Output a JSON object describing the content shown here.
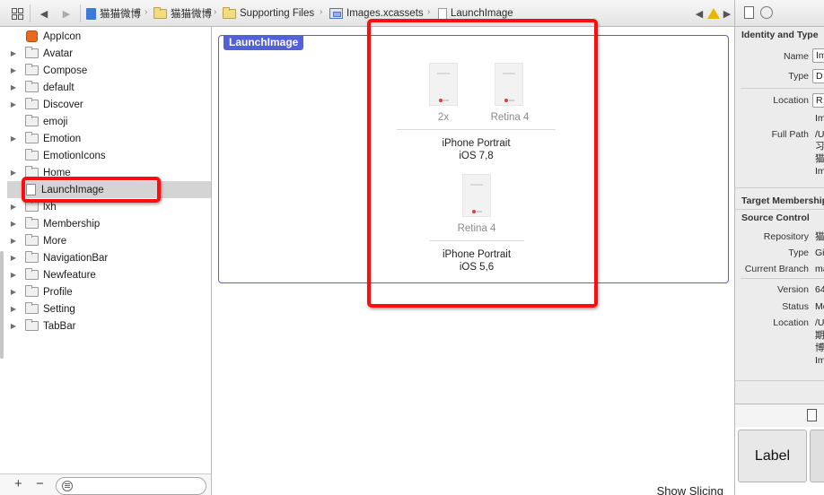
{
  "jumpbar": {
    "breadcrumbs": [
      {
        "label": "猫猫微博",
        "icon": "project-icon"
      },
      {
        "label": "猫猫微博",
        "icon": "folder-icon"
      },
      {
        "label": "Supporting Files",
        "icon": "folder-icon"
      },
      {
        "label": "Images.xcassets",
        "icon": "xcassets-icon"
      },
      {
        "label": "LaunchImage",
        "icon": "launch-image-icon"
      }
    ]
  },
  "navigator": {
    "items": [
      {
        "label": "AppIcon",
        "icon": "app-icon-set-icon",
        "expandable": false,
        "selected": false
      },
      {
        "label": "Avatar",
        "icon": "folder-icon",
        "expandable": true,
        "selected": false
      },
      {
        "label": "Compose",
        "icon": "folder-icon",
        "expandable": true,
        "selected": false
      },
      {
        "label": "default",
        "icon": "folder-icon",
        "expandable": true,
        "selected": false
      },
      {
        "label": "Discover",
        "icon": "folder-icon",
        "expandable": true,
        "selected": false
      },
      {
        "label": "emoji",
        "icon": "folder-icon",
        "expandable": false,
        "selected": false
      },
      {
        "label": "Emotion",
        "icon": "folder-icon",
        "expandable": true,
        "selected": false
      },
      {
        "label": "EmotionIcons",
        "icon": "folder-icon",
        "expandable": false,
        "selected": false
      },
      {
        "label": "Home",
        "icon": "folder-icon",
        "expandable": true,
        "selected": false
      },
      {
        "label": "LaunchImage",
        "icon": "launch-image-icon",
        "expandable": false,
        "selected": true
      },
      {
        "label": "lxh",
        "icon": "folder-icon",
        "expandable": true,
        "selected": false
      },
      {
        "label": "Membership",
        "icon": "folder-icon",
        "expandable": true,
        "selected": false
      },
      {
        "label": "More",
        "icon": "folder-icon",
        "expandable": true,
        "selected": false
      },
      {
        "label": "NavigationBar",
        "icon": "folder-icon",
        "expandable": true,
        "selected": false
      },
      {
        "label": "Newfeature",
        "icon": "folder-icon",
        "expandable": true,
        "selected": false
      },
      {
        "label": "Profile",
        "icon": "folder-icon",
        "expandable": true,
        "selected": false
      },
      {
        "label": "Setting",
        "icon": "folder-icon",
        "expandable": true,
        "selected": false
      },
      {
        "label": "TabBar",
        "icon": "folder-icon",
        "expandable": true,
        "selected": false
      }
    ],
    "bottom": {
      "add_label": "+",
      "remove_label": "−"
    }
  },
  "editor": {
    "asset_title": "LaunchImage",
    "groups": [
      {
        "slots": [
          "2x",
          "Retina 4"
        ],
        "line1": "iPhone Portrait",
        "line2": "iOS 7,8"
      },
      {
        "slots": [
          "Retina 4"
        ],
        "line1": "iPhone Portrait",
        "line2": "iOS 5,6"
      }
    ],
    "show_slicing": "Show Slicing",
    "highlight_color": "#ff0c0c",
    "asset_accent": "#5260da"
  },
  "inspector": {
    "identity_title": "Identity and Type",
    "name_label": "Name",
    "name_value": "Im",
    "type_label": "Type",
    "type_value": "D",
    "location_label": "Location",
    "location_value": "R",
    "location_extra": "Im",
    "fullpath_label": "Full Path",
    "fullpath_lines": [
      "/U",
      "习",
      "猫",
      "Im"
    ],
    "target_title": "Target Membership",
    "source_title": "Source Control",
    "repository_label": "Repository",
    "repository_value": "猫",
    "sc_type_label": "Type",
    "sc_type_value": "Gi",
    "branch_label": "Current Branch",
    "branch_value": "ma",
    "version_label": "Version",
    "version_value": "64",
    "status_label": "Status",
    "status_value": "Mo",
    "sc_location_label": "Location",
    "sc_location_lines": [
      "/U",
      "期",
      "博",
      "Im"
    ],
    "library_tile_label": "Label"
  }
}
